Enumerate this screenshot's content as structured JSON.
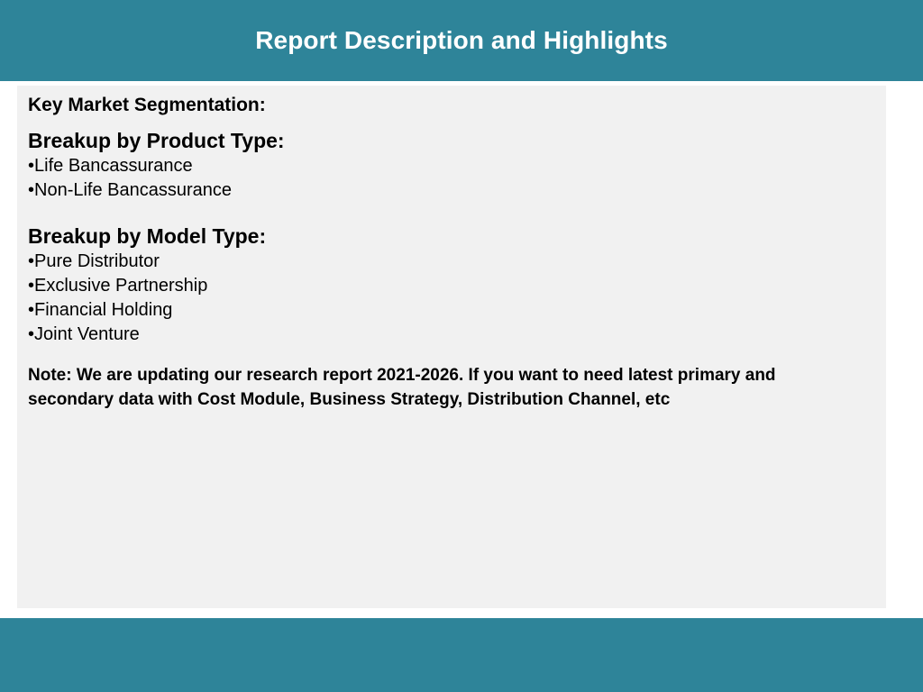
{
  "header": {
    "title": "Report Description and Highlights"
  },
  "content": {
    "segmentation_title": "Key Market Segmentation:",
    "product_type": {
      "heading": "Breakup by Product Type:",
      "items": [
        "Life Bancassurance",
        "Non-Life Bancassurance"
      ]
    },
    "model_type": {
      "heading": "Breakup by Model Type:",
      "items": [
        "Pure Distributor",
        "Exclusive Partnership",
        "Financial Holding",
        "Joint Venture"
      ]
    },
    "note": "Note: We are updating our research report 2021-2026. If you want to need latest primary and secondary data with Cost Module, Business Strategy, Distribution Channel, etc"
  },
  "colors": {
    "header_bg": "#2e8499",
    "content_bg": "#f1f1f1",
    "footer_bg": "#2e8499"
  }
}
